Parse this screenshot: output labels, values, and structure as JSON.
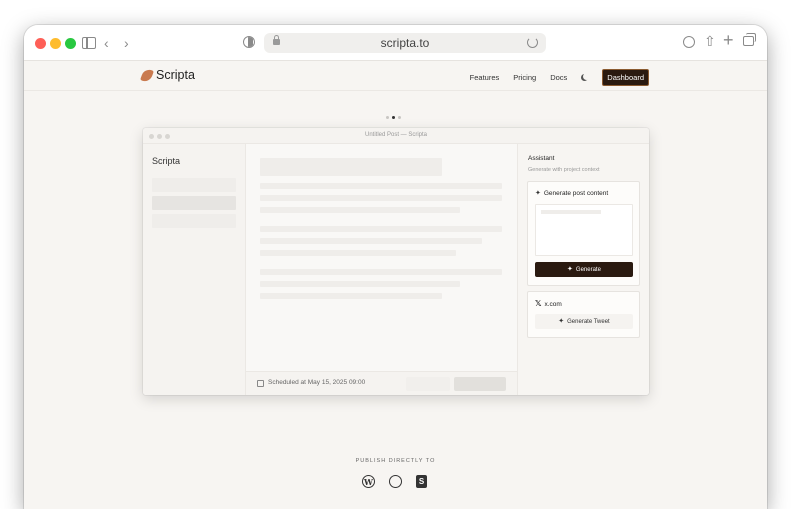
{
  "browser": {
    "url": "scripta.to"
  },
  "site": {
    "brand": "Scripta",
    "nav": {
      "features": "Features",
      "pricing": "Pricing",
      "docs": "Docs",
      "dashboard": "Dashboard"
    }
  },
  "carousel": {
    "count": 3,
    "active": 2
  },
  "app": {
    "window_title": "Untitled Post — Scripta",
    "sidebar_title": "Scripta",
    "schedule_text": "Scheduled at May 15, 2025 09:00",
    "assistant": {
      "title": "Assistant",
      "subtitle": "Generate with project context",
      "post_card_title": "Generate post content",
      "generate_label": "Generate",
      "x_card_title": "x.com",
      "tweet_label": "Generate Tweet"
    }
  },
  "publish": {
    "label": "PUBLISH DIRECTLY TO",
    "icons": [
      "wordpress-icon",
      "ghost-icon",
      "shopify-icon"
    ]
  },
  "colors": {
    "accent_dark": "#2a1a10",
    "brand_logo": "#c97a4f"
  }
}
